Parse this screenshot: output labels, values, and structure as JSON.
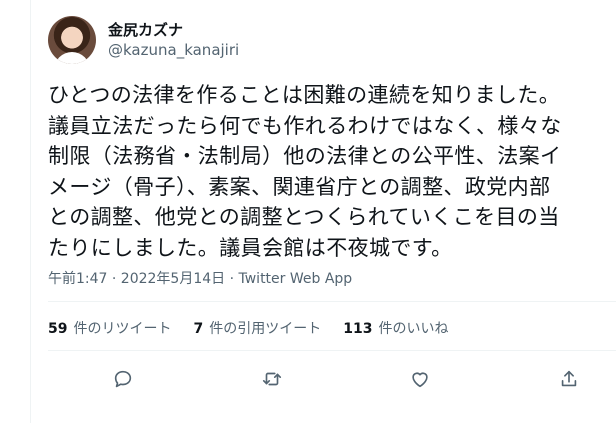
{
  "author": {
    "display_name": "金尻カズナ",
    "handle": "@kazuna_kanajiri"
  },
  "tweet": {
    "lines": [
      "ひとつの法律を作ることは困難の連続を知りました。",
      "議員立法だったら何でも作れるわけではなく、様々な",
      "制限（法務省・法制局）他の法律との公平性、法案イ",
      "メージ（骨子）、素案、関連省庁との調整、政党内部",
      "との調整、他党との調整とつくられていくこを目の当",
      "たりにしました。議員会館は不夜城です。"
    ],
    "timestamp": "午前1:47 · 2022年5月14日 · Twitter Web App"
  },
  "stats": {
    "retweets_count": "59",
    "retweets_label": "件のリツイート",
    "quotes_count": "7",
    "quotes_label": "件の引用ツイート",
    "likes_count": "113",
    "likes_label": "件のいいね"
  },
  "actions": {
    "reply_icon": "reply-icon",
    "retweet_icon": "retweet-icon",
    "like_icon": "heart-icon",
    "share_icon": "share-icon"
  },
  "colors": {
    "text": "#0f1419",
    "secondary": "#536471",
    "border": "#eff3f4"
  }
}
